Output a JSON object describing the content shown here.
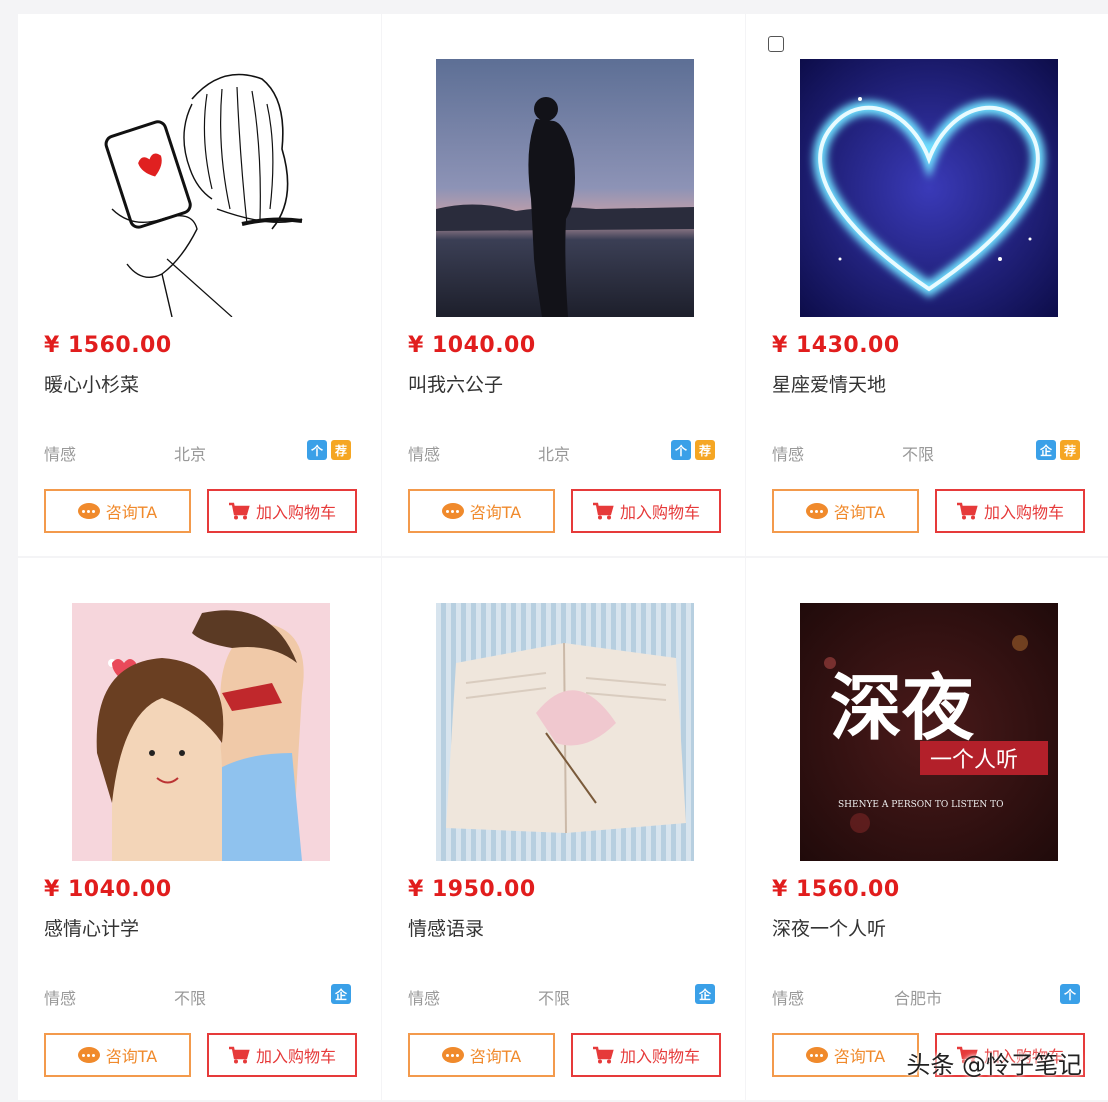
{
  "products": [
    {
      "price": "¥ 1560.00",
      "name": "暖心小杉菜",
      "category": "情感",
      "city": "北京",
      "badges": [
        "个",
        "荐"
      ]
    },
    {
      "price": "¥ 1040.00",
      "name": "叫我六公子",
      "category": "情感",
      "city": "北京",
      "badges": [
        "个",
        "荐"
      ]
    },
    {
      "price": "¥ 1430.00",
      "name": "星座爱情天地",
      "category": "情感",
      "city": "不限",
      "badges": [
        "企",
        "荐"
      ]
    },
    {
      "price": "¥ 1040.00",
      "name": "感情心计学",
      "category": "情感",
      "city": "不限",
      "badges": [
        "企"
      ]
    },
    {
      "price": "¥ 1950.00",
      "name": "情感语录",
      "category": "情感",
      "city": "不限",
      "badges": [
        "企"
      ]
    },
    {
      "price": "¥ 1560.00",
      "name": "深夜一个人听",
      "category": "情感",
      "city": "合肥市",
      "badges": [
        "个"
      ]
    }
  ],
  "buttons": {
    "consult": "咨询TA",
    "cart": "加入购物车"
  },
  "image_text": {
    "big": "深夜",
    "small": "一个人听",
    "sub": "SHENYE A PERSON TO LISTEN TO"
  },
  "watermark": "头条 @怜子笔记",
  "colors": {
    "price": "#e11d1d",
    "consult": "#f08a2c",
    "cart": "#e63a3a",
    "badge_blue": "#3aa0e8",
    "badge_orange": "#f5a623"
  }
}
